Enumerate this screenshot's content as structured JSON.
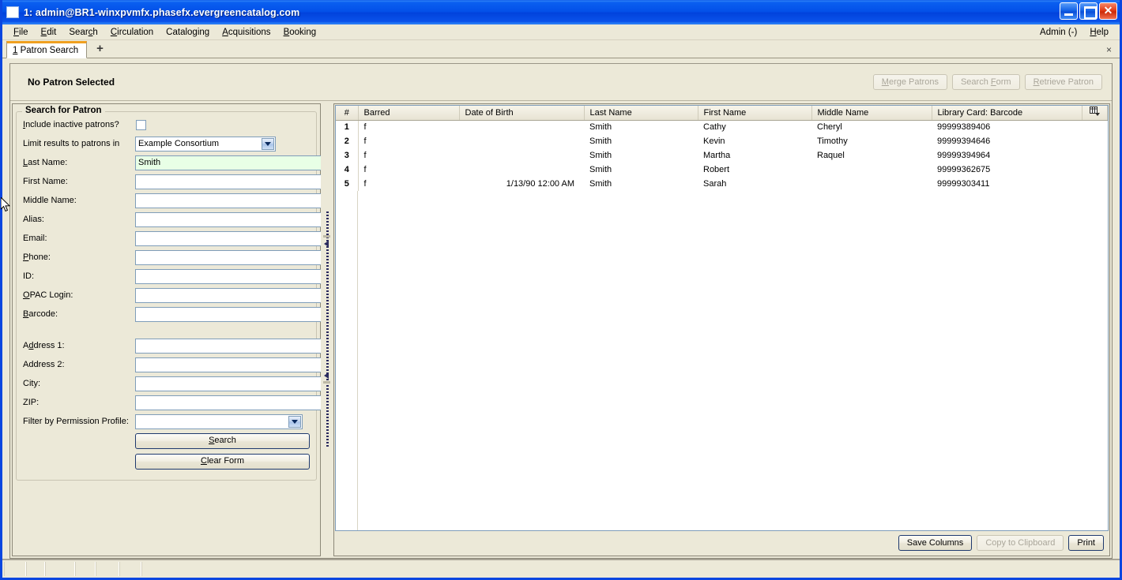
{
  "window": {
    "title": "1: admin@BR1-winxpvmfx.phasefx.evergreencatalog.com",
    "icon": "window-icon",
    "minimize_label": "Minimize",
    "maximize_label": "Maximize",
    "close_label": "Close"
  },
  "menubar": {
    "items": [
      {
        "label": "File",
        "accel": "F"
      },
      {
        "label": "Edit",
        "accel": "E"
      },
      {
        "label": "Search",
        "accel": "c"
      },
      {
        "label": "Circulation",
        "accel": "C"
      },
      {
        "label": "Cataloging",
        "accel": "g"
      },
      {
        "label": "Acquisitions",
        "accel": "A"
      },
      {
        "label": "Booking",
        "accel": "B"
      }
    ],
    "right_items": [
      {
        "label": "Admin (-)"
      },
      {
        "label": "Help"
      }
    ]
  },
  "tabbar": {
    "active_tab": "1 Patron Search",
    "new_tab_label": "+",
    "close_label": "×"
  },
  "patron_header": {
    "status": "No Patron Selected",
    "buttons": [
      {
        "label": "Merge Patrons",
        "enabled": false
      },
      {
        "label": "Search Form",
        "enabled": false
      },
      {
        "label": "Retrieve Patron",
        "enabled": false
      }
    ]
  },
  "search_form": {
    "legend": "Search for Patron",
    "include_inactive_label": "Include inactive patrons?",
    "include_inactive_checked": false,
    "limit_results_label": "Limit results to patrons in",
    "limit_results_value": "Example Consortium",
    "fields": [
      {
        "label": "Last Name:",
        "value": "Smith",
        "focused": true
      },
      {
        "label": "First Name:",
        "value": "",
        "focused": false
      },
      {
        "label": "Middle Name:",
        "value": "",
        "focused": false
      },
      {
        "label": "Alias:",
        "value": "",
        "focused": false
      },
      {
        "label": "Email:",
        "value": "",
        "focused": false
      },
      {
        "label": "Phone:",
        "value": "",
        "focused": false
      },
      {
        "label": "ID:",
        "value": "",
        "focused": false
      },
      {
        "label": "OPAC Login:",
        "value": "",
        "focused": false
      },
      {
        "label": "Barcode:",
        "value": "",
        "focused": false
      }
    ],
    "address_fields": [
      {
        "label": "Address 1:",
        "value": ""
      },
      {
        "label": "Address 2:",
        "value": ""
      },
      {
        "label": "City:",
        "value": ""
      },
      {
        "label": "ZIP:",
        "value": ""
      }
    ],
    "permission_profile_label": "Filter by Permission Profile:",
    "permission_profile_value": "",
    "search_button": "Search",
    "clear_button": "Clear Form"
  },
  "results": {
    "columns": [
      {
        "key": "num",
        "label": "#",
        "width": 28
      },
      {
        "key": "barred",
        "label": "Barred",
        "width": 128
      },
      {
        "key": "dob",
        "label": "Date of Birth",
        "width": 158
      },
      {
        "key": "last",
        "label": "Last Name",
        "width": 144
      },
      {
        "key": "first",
        "label": "First Name",
        "width": 144
      },
      {
        "key": "middle",
        "label": "Middle Name",
        "width": 152
      },
      {
        "key": "barcode",
        "label": "Library Card: Barcode",
        "width": 190
      }
    ],
    "column_picker_icon": "column-picker-icon",
    "rows": [
      {
        "num": "1",
        "barred": "f",
        "dob": "",
        "last": "Smith",
        "first": "Cathy",
        "middle": "Cheryl",
        "barcode": "99999389406"
      },
      {
        "num": "2",
        "barred": "f",
        "dob": "",
        "last": "Smith",
        "first": "Kevin",
        "middle": "Timothy",
        "barcode": "99999394646"
      },
      {
        "num": "3",
        "barred": "f",
        "dob": "",
        "last": "Smith",
        "first": "Martha",
        "middle": "Raquel",
        "barcode": "99999394964"
      },
      {
        "num": "4",
        "barred": "f",
        "dob": "",
        "last": "Smith",
        "first": "Robert",
        "middle": "",
        "barcode": "99999362675"
      },
      {
        "num": "5",
        "barred": "f",
        "dob": "1/13/90 12:00 AM",
        "last": "Smith",
        "first": "Sarah",
        "middle": "",
        "barcode": "99999303411"
      }
    ],
    "bottom_buttons": [
      {
        "label": "Save Columns",
        "enabled": true,
        "default": true
      },
      {
        "label": "Copy to Clipboard",
        "enabled": false,
        "default": false
      },
      {
        "label": "Print",
        "enabled": true,
        "default": true
      }
    ]
  },
  "statusbar": {
    "segments": [
      "",
      "",
      "",
      "",
      "",
      "",
      ""
    ]
  },
  "colors": {
    "titlebar_blue": "#0a46e0",
    "chrome_beige": "#ece9d8",
    "focus_field_green": "#e8ffe6",
    "field_border_blue": "#7f9db9",
    "active_tab_accent": "#f0a020"
  }
}
